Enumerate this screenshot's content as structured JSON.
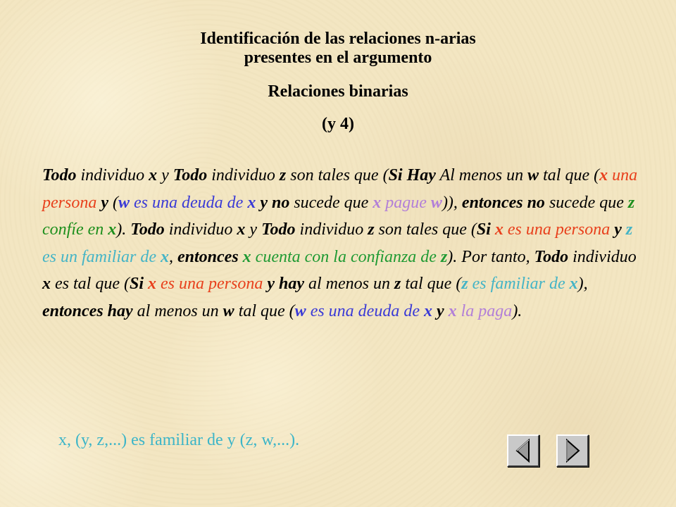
{
  "header": {
    "title_line_1": "Identificación de las relaciones n-arias",
    "title_line_2": "presentes en el argumento",
    "subtitle": "Relaciones binarias",
    "part_label": "(y 4)"
  },
  "argument": {
    "segments": [
      {
        "text": "Todo",
        "bold": true,
        "color": "black"
      },
      {
        "text": " individuo ",
        "bold": false,
        "color": "black"
      },
      {
        "text": "x",
        "bold": true,
        "color": "black"
      },
      {
        "text": " y ",
        "bold": false,
        "color": "black"
      },
      {
        "text": "Todo",
        "bold": true,
        "color": "black"
      },
      {
        "text": " individuo ",
        "bold": false,
        "color": "black"
      },
      {
        "text": "z",
        "bold": true,
        "color": "black"
      },
      {
        "text": " son tales que (",
        "bold": false,
        "color": "black"
      },
      {
        "text": "Si  Hay",
        "bold": true,
        "color": "black"
      },
      {
        "text": " Al menos un ",
        "bold": false,
        "color": "black"
      },
      {
        "text": "w",
        "bold": true,
        "color": "black"
      },
      {
        "text": " tal que (",
        "bold": false,
        "color": "black"
      },
      {
        "text": "x",
        "bold": true,
        "color": "red"
      },
      {
        "text": " una persona ",
        "bold": false,
        "color": "red"
      },
      {
        "text": "y",
        "bold": true,
        "color": "black"
      },
      {
        "text": " (",
        "bold": false,
        "color": "black"
      },
      {
        "text": "w",
        "bold": true,
        "color": "blue"
      },
      {
        "text": " es una deuda de ",
        "bold": false,
        "color": "blue"
      },
      {
        "text": "x",
        "bold": true,
        "color": "blue"
      },
      {
        "text": " ",
        "bold": false,
        "color": "black"
      },
      {
        "text": "y no",
        "bold": true,
        "color": "black"
      },
      {
        "text": " sucede que ",
        "bold": false,
        "color": "black"
      },
      {
        "text": "x",
        "bold": true,
        "color": "violet"
      },
      {
        "text": " pague ",
        "bold": false,
        "color": "violet"
      },
      {
        "text": "w",
        "bold": true,
        "color": "violet"
      },
      {
        "text": ")), ",
        "bold": false,
        "color": "black"
      },
      {
        "text": "entonces no",
        "bold": true,
        "color": "black"
      },
      {
        "text": " sucede que ",
        "bold": false,
        "color": "black"
      },
      {
        "text": "z",
        "bold": true,
        "color": "lime"
      },
      {
        "text": " confíe en ",
        "bold": false,
        "color": "lime"
      },
      {
        "text": "x",
        "bold": true,
        "color": "lime"
      },
      {
        "text": "). ",
        "bold": false,
        "color": "black"
      },
      {
        "text": "Todo",
        "bold": true,
        "color": "black"
      },
      {
        "text": " individuo ",
        "bold": false,
        "color": "black"
      },
      {
        "text": "x",
        "bold": true,
        "color": "black"
      },
      {
        "text": " y ",
        "bold": false,
        "color": "black"
      },
      {
        "text": "Todo",
        "bold": true,
        "color": "black"
      },
      {
        "text": " individuo ",
        "bold": false,
        "color": "black"
      },
      {
        "text": "z",
        "bold": true,
        "color": "black"
      },
      {
        "text": " son tales que (",
        "bold": false,
        "color": "black"
      },
      {
        "text": "Si",
        "bold": true,
        "color": "black"
      },
      {
        "text": " ",
        "bold": false,
        "color": "black"
      },
      {
        "text": "x",
        "bold": true,
        "color": "red"
      },
      {
        "text": " es una persona ",
        "bold": false,
        "color": "red"
      },
      {
        "text": "y",
        "bold": true,
        "color": "black"
      },
      {
        "text": " ",
        "bold": false,
        "color": "black"
      },
      {
        "text": "z",
        "bold": true,
        "color": "cyan"
      },
      {
        "text": " es un familiar de ",
        "bold": false,
        "color": "cyan"
      },
      {
        "text": "x",
        "bold": true,
        "color": "cyan"
      },
      {
        "text": ", ",
        "bold": false,
        "color": "black"
      },
      {
        "text": "entonces",
        "bold": true,
        "color": "black"
      },
      {
        "text": " ",
        "bold": false,
        "color": "black"
      },
      {
        "text": "x",
        "bold": true,
        "color": "green"
      },
      {
        "text": " cuenta con la confianza de ",
        "bold": false,
        "color": "green"
      },
      {
        "text": "z",
        "bold": true,
        "color": "green"
      },
      {
        "text": "). Por tanto, ",
        "bold": false,
        "color": "black"
      },
      {
        "text": "Todo",
        "bold": true,
        "color": "black"
      },
      {
        "text": " individuo ",
        "bold": false,
        "color": "black"
      },
      {
        "text": "x",
        "bold": true,
        "color": "black"
      },
      {
        "text": " es tal que (",
        "bold": false,
        "color": "black"
      },
      {
        "text": "Si",
        "bold": true,
        "color": "black"
      },
      {
        "text": "  ",
        "bold": false,
        "color": "black"
      },
      {
        "text": "x",
        "bold": true,
        "color": "red"
      },
      {
        "text": " es una persona ",
        "bold": false,
        "color": "red"
      },
      {
        "text": "y hay",
        "bold": true,
        "color": "black"
      },
      {
        "text": " al menos un ",
        "bold": false,
        "color": "black"
      },
      {
        "text": "z",
        "bold": true,
        "color": "black"
      },
      {
        "text": " tal que (",
        "bold": false,
        "color": "black"
      },
      {
        "text": "z",
        "bold": true,
        "color": "cyan"
      },
      {
        "text": " es familiar de ",
        "bold": false,
        "color": "cyan"
      },
      {
        "text": "x",
        "bold": true,
        "color": "cyan"
      },
      {
        "text": "), ",
        "bold": false,
        "color": "black"
      },
      {
        "text": "entonces hay",
        "bold": true,
        "color": "black"
      },
      {
        "text": " al menos un ",
        "bold": false,
        "color": "black"
      },
      {
        "text": "w",
        "bold": true,
        "color": "black"
      },
      {
        "text": " tal que (",
        "bold": false,
        "color": "black"
      },
      {
        "text": "w",
        "bold": true,
        "color": "blue"
      },
      {
        "text": " es una deuda de ",
        "bold": false,
        "color": "blue"
      },
      {
        "text": "x",
        "bold": true,
        "color": "blue"
      },
      {
        "text": " ",
        "bold": false,
        "color": "black"
      },
      {
        "text": "y",
        "bold": true,
        "color": "black"
      },
      {
        "text": " ",
        "bold": false,
        "color": "black"
      },
      {
        "text": "x",
        "bold": true,
        "color": "violet"
      },
      {
        "text": " la paga",
        "bold": false,
        "color": "violet"
      },
      {
        "text": ").",
        "bold": false,
        "color": "black"
      }
    ]
  },
  "footnote": "x, (y, z,...) es familiar de y (z, w,...).",
  "navigation": {
    "prev_icon": "triangle-left-icon",
    "next_icon": "triangle-right-icon"
  },
  "colors": {
    "black": "#000000",
    "red": "#e8401c",
    "blue": "#3a3ad6",
    "green": "#1f9a33",
    "lime": "#1d8f1d",
    "cyan": "#44b4c6",
    "violet": "#b27fd8",
    "background": "#f3e6c2"
  }
}
